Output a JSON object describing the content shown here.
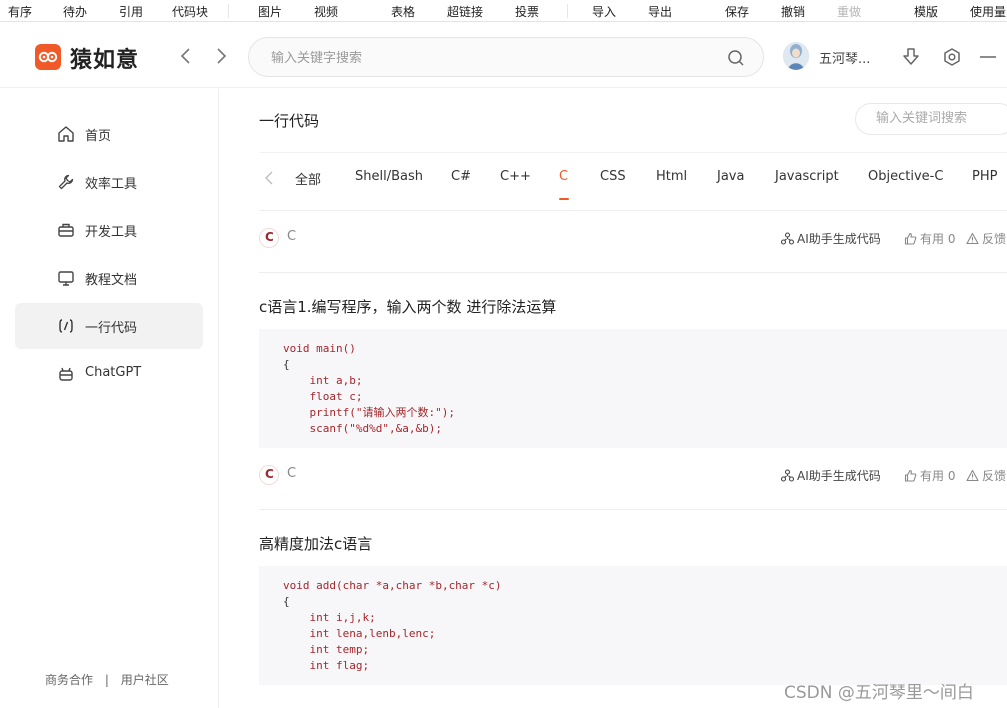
{
  "toolbar": {
    "items": [
      "有序",
      "待办",
      "引用",
      "代码块",
      "图片",
      "视频",
      "表格",
      "超链接",
      "投票",
      "导入",
      "导出",
      "保存",
      "撤销",
      "重做",
      "模版",
      "使用量"
    ]
  },
  "header": {
    "logo_text": "猿如意",
    "search_placeholder": "输入关键字搜索",
    "username": "五河琴..."
  },
  "sidebar": {
    "items": [
      {
        "label": "首页",
        "icon": "home-icon"
      },
      {
        "label": "效率工具",
        "icon": "wrench-icon"
      },
      {
        "label": "开发工具",
        "icon": "toolbox-icon"
      },
      {
        "label": "教程文档",
        "icon": "monitor-icon"
      },
      {
        "label": "一行代码",
        "icon": "code-icon",
        "active": true
      },
      {
        "label": "ChatGPT",
        "icon": "robot-icon"
      }
    ],
    "footer": {
      "left": "商务合作",
      "sep": "|",
      "right": "用户社区"
    }
  },
  "main": {
    "title": "一行代码",
    "search_placeholder": "输入关键词搜索",
    "tabs": [
      "全部",
      "Shell/Bash",
      "C#",
      "C++",
      "C",
      "CSS",
      "Html",
      "Java",
      "Javascript",
      "Objective-C",
      "PHP"
    ],
    "active_tab": "C",
    "meta": {
      "lang_badge": "C",
      "lang_name": "C",
      "ai_label": "AI助手生成代码",
      "useful_label": "有用 0",
      "feedback_label": "反馈"
    },
    "snippets": [
      {
        "title": "c语言1.编写程序，输入两个数 进行除法运算",
        "code": [
          "void main()",
          "{",
          "    int a,b;",
          "    float c;",
          "    printf(\"请输入两个数:\");",
          "    scanf(\"%d%d\",&a,&b);"
        ]
      },
      {
        "title": "高精度加法c语言",
        "code": [
          "void add(char *a,char *b,char *c)",
          "{",
          "    int i,j,k;",
          "    int lena,lenb,lenc;",
          "    int temp;",
          "    int flag;"
        ]
      }
    ]
  },
  "watermark": "CSDN @五河琴里～间白",
  "colors": {
    "accent": "#f05a28",
    "badge": "#a2272d",
    "code_bg": "#f7f7f9"
  }
}
